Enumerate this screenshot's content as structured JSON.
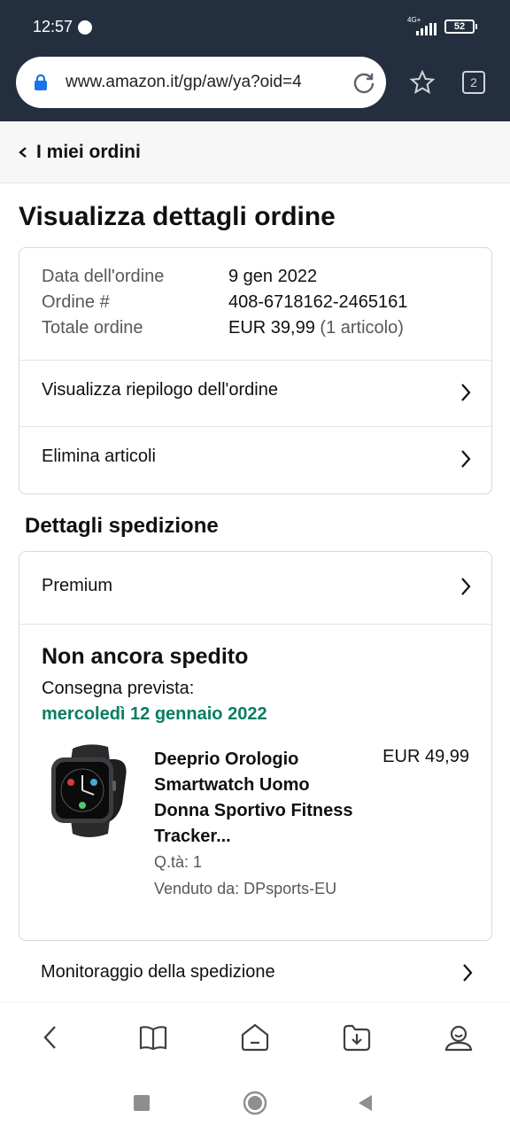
{
  "status_bar": {
    "time": "12:57",
    "network": "4G+",
    "battery": "52"
  },
  "browser": {
    "url": "www.amazon.it/gp/aw/ya?oid=4",
    "tab_count": "2"
  },
  "header": {
    "back_label": "I miei ordini"
  },
  "page": {
    "title": "Visualizza dettagli ordine"
  },
  "order": {
    "date_label": "Data dell'ordine",
    "date_value": "9 gen 2022",
    "number_label": "Ordine #",
    "number_value": "408-6718162-2465161",
    "total_label": "Totale ordine",
    "total_value": "EUR 39,99",
    "total_items": "(1 articolo)",
    "summary_link": "Visualizza riepilogo dell'ordine",
    "delete_link": "Elimina articoli"
  },
  "shipping": {
    "section_title": "Dettagli spedizione",
    "method": "Premium",
    "status": "Non ancora spedito",
    "delivery_label": "Consegna prevista:",
    "delivery_date": "mercoledì 12 gennaio 2022",
    "item": {
      "title": "Deeprio Orologio Smartwatch Uomo Donna Sportivo Fitness Tracker...",
      "price": "EUR 49,99",
      "qty": "Q.tà: 1",
      "seller": "Venduto da: DPsports-EU"
    },
    "tracking_link": "Monitoraggio della spedizione"
  },
  "colors": {
    "header_bg": "#232f3e",
    "delivery_green": "#067d62",
    "text": "#0f1111",
    "muted": "#565959"
  },
  "icons": {
    "bottom_nav": [
      "back-icon",
      "bookmarks-icon",
      "home-icon",
      "downloads-icon",
      "account-icon"
    ],
    "system_nav": [
      "recents-icon",
      "home-circle-icon",
      "back-triangle-icon"
    ]
  }
}
